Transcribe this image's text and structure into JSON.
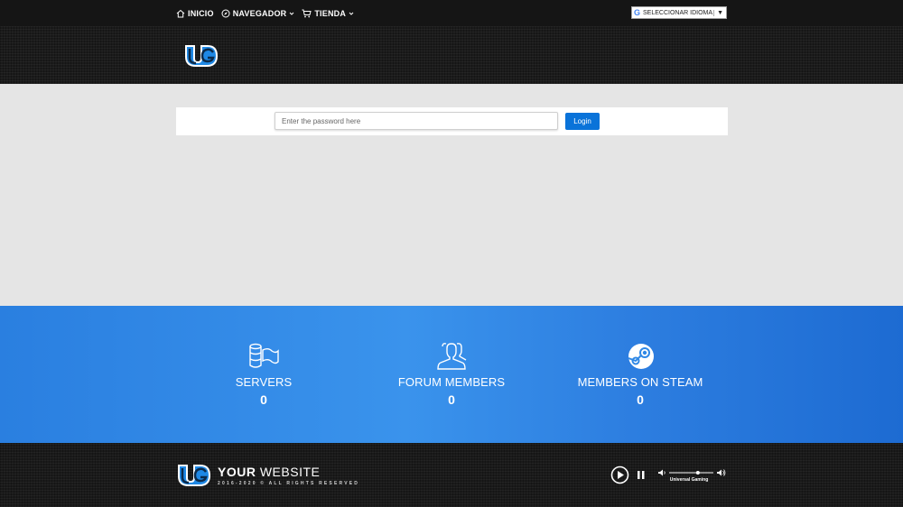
{
  "nav": {
    "items": [
      {
        "label": "INICIO",
        "icon": "home-icon",
        "dropdown": false
      },
      {
        "label": "NAVEGADOR",
        "icon": "compass-icon",
        "dropdown": true
      },
      {
        "label": "TIENDA",
        "icon": "cart-icon",
        "dropdown": true
      }
    ],
    "language": {
      "g": "G",
      "label": "SELECCIONAR IDIOMA",
      "arrow": "▼"
    }
  },
  "login": {
    "placeholder": "Enter the password here",
    "value": "",
    "button_label": "Login"
  },
  "stats": [
    {
      "label": "SERVERS",
      "value": "0",
      "icon": "server-flag-icon"
    },
    {
      "label": "FORUM MEMBERS",
      "value": "0",
      "icon": "users-icon"
    },
    {
      "label": "MEMBERS ON STEAM",
      "value": "0",
      "icon": "steam-icon"
    }
  ],
  "footer": {
    "brand_bold": "YOUR",
    "brand_light": "WEBSITE",
    "copyright": "2016-2020 © ALL RIGHTS RESERVED",
    "player": {
      "track": "Universal Gaming",
      "volume": 0.65
    }
  },
  "colors": {
    "accent": "#0a73d9",
    "stats_band": "#2f88e6",
    "nav_bg": "#151515"
  }
}
